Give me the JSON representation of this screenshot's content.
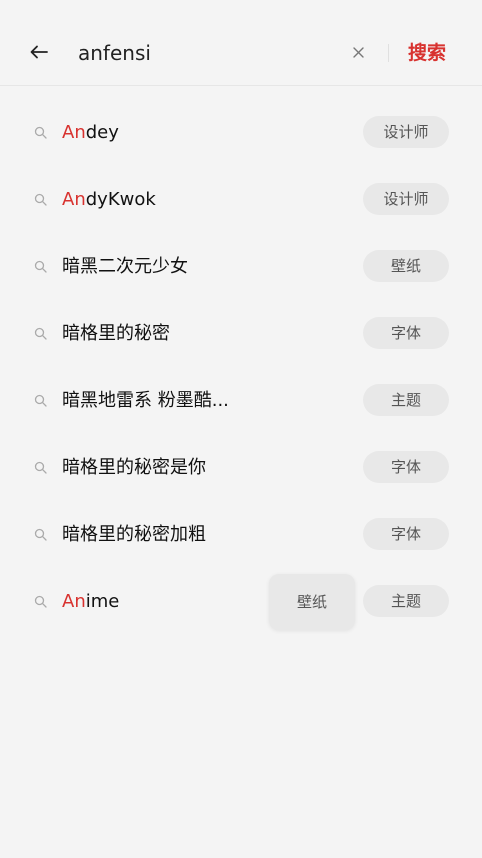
{
  "search": {
    "query": "anfensi",
    "submit_label": "搜索"
  },
  "icons": {
    "back": "arrow-left-icon",
    "clear": "close-icon",
    "suggestion": "search-icon"
  },
  "colors": {
    "accent": "#d8322f",
    "background": "#f4f4f4",
    "tag_background": "#e8e8e8"
  },
  "suggestions": [
    {
      "highlight": "An",
      "rest": "dey",
      "tag": "设计师"
    },
    {
      "highlight": "An",
      "rest": "dyKwok",
      "tag": "设计师"
    },
    {
      "highlight": "",
      "rest": "暗黑二次元少女",
      "tag": "壁纸"
    },
    {
      "highlight": "",
      "rest": "暗格里的秘密",
      "tag": "字体"
    },
    {
      "highlight": "",
      "rest": "暗黑地雷系 粉墨酷...",
      "tag": "主题"
    },
    {
      "highlight": "",
      "rest": "暗格里的秘密是你",
      "tag": "字体"
    },
    {
      "highlight": "",
      "rest": "暗格里的秘密加粗",
      "tag": "字体"
    },
    {
      "highlight": "An",
      "rest": "ime",
      "tag": "主题"
    }
  ],
  "popup": {
    "label": "壁纸"
  }
}
